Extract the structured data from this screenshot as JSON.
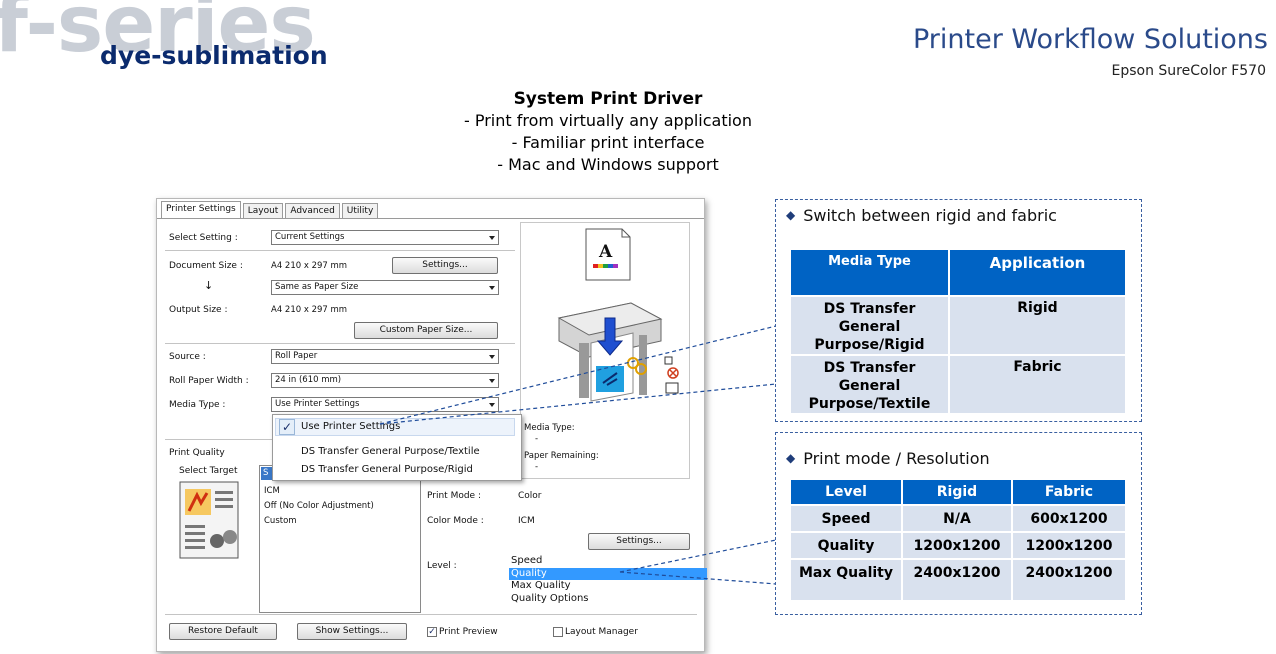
{
  "header": {
    "brand_big": "f-series",
    "brand_sub": "dye-sublimation",
    "title": "Printer Workflow Solutions",
    "subtitle": "Epson SureColor F570"
  },
  "intro": {
    "title": "System Print Driver",
    "bullets": [
      "-  Print from virtually any application",
      "-  Familiar print interface",
      "-  Mac and Windows support"
    ]
  },
  "dialog": {
    "tabs": [
      "Printer Settings",
      "Layout",
      "Advanced",
      "Utility"
    ],
    "select_setting": {
      "label": "Select Setting :",
      "value": "Current Settings"
    },
    "document_size": {
      "label": "Document Size :",
      "value": "A4 210 x 297 mm",
      "button": "Settings..."
    },
    "arrow": "↓",
    "same_as": "Same as Paper Size",
    "output_size": {
      "label": "Output Size :",
      "value": "A4 210 x 297 mm"
    },
    "custom_paper_button": "Custom Paper Size...",
    "source": {
      "label": "Source :",
      "value": "Roll Paper"
    },
    "roll_width": {
      "label": "Roll Paper Width :",
      "value": "24 in (610 mm)"
    },
    "media_type": {
      "label": "Media Type :",
      "value": "Use Printer Settings"
    },
    "media_popup": {
      "check": "✓",
      "items": [
        "Use Printer Settings",
        "DS Transfer General Purpose/Textile",
        "DS Transfer General Purpose/Rigid"
      ]
    },
    "preview_info": {
      "media_type_label": "Media Type:",
      "media_type_value": "-",
      "paper_remaining_label": "Paper Remaining:",
      "paper_remaining_value": "-"
    },
    "print_quality": {
      "label": "Print Quality",
      "select_target": "Select Target",
      "targets_first": "S",
      "targets": [
        "ICM",
        "Off (No Color Adjustment)",
        "Custom"
      ]
    },
    "print_mode": {
      "label": "Print Mode :",
      "value": "Color"
    },
    "color_mode": {
      "label": "Color Mode :",
      "value": "ICM"
    },
    "settings_button": "Settings...",
    "level": {
      "label": "Level :",
      "options": [
        "Speed",
        "Quality",
        "Max Quality",
        "Quality Options"
      ],
      "selected_index": 1
    },
    "bottom": {
      "restore_default": "Restore Default",
      "show_settings": "Show Settings...",
      "print_preview": "Print Preview",
      "print_preview_checked": true,
      "layout_manager": "Layout Manager",
      "layout_manager_checked": false
    }
  },
  "panel1": {
    "heading": "Switch between rigid and fabric",
    "bullet": "◆",
    "headers": [
      "Media Type",
      "Application"
    ],
    "rows": [
      [
        "DS Transfer General Purpose/Rigid",
        "Rigid"
      ],
      [
        "DS Transfer General Purpose/Textile",
        "Fabric"
      ]
    ]
  },
  "panel2": {
    "heading": "Print mode / Resolution",
    "bullet": "◆",
    "headers": [
      "Level",
      "Rigid",
      "Fabric"
    ],
    "rows": [
      [
        "Speed",
        "N/A",
        "600x1200"
      ],
      [
        "Quality",
        "1200x1200",
        "1200x1200"
      ],
      [
        "Max Quality",
        "2400x1200",
        "2400x1200"
      ]
    ]
  },
  "colors": {
    "brand_gray": "#c9ced6",
    "brand_navy": "#0b2b6e",
    "table_header": "#0063c4",
    "table_cell": "#d9e1ee",
    "selection": "#3399ff",
    "connector": "#1f4c9a"
  }
}
